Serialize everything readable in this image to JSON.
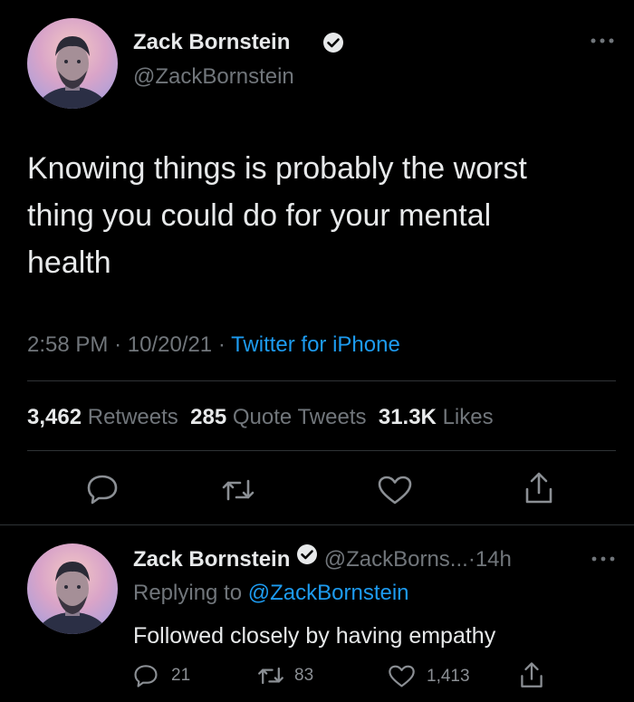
{
  "main_tweet": {
    "display_name": "Zack Bornstein",
    "handle": "@ZackBornstein",
    "text_lines": [
      "Knowing things is probably the worst",
      "thing you could do for your mental",
      "health"
    ],
    "time": "2:58 PM",
    "date": "10/20/21",
    "source": "Twitter for iPhone",
    "retweets_count": "3,462",
    "retweets_label": "Retweets",
    "quotes_count": "285",
    "quotes_label": "Quote Tweets",
    "likes_count": "31.3K",
    "likes_label": "Likes"
  },
  "reply": {
    "display_name": "Zack Bornstein",
    "handle": "@ZackBorns...",
    "age": "14h",
    "replying_prefix": "Replying to",
    "replying_to": "@ZackBornstein",
    "text": "Followed closely by having empathy",
    "reply_count": "21",
    "retweet_count": "83",
    "like_count": "1,413"
  },
  "separator": "·",
  "colors": {
    "background": "#000000",
    "text": "#e7e9ea",
    "muted": "#71767b",
    "link": "#1d9bf0",
    "divider": "#2f3336"
  }
}
